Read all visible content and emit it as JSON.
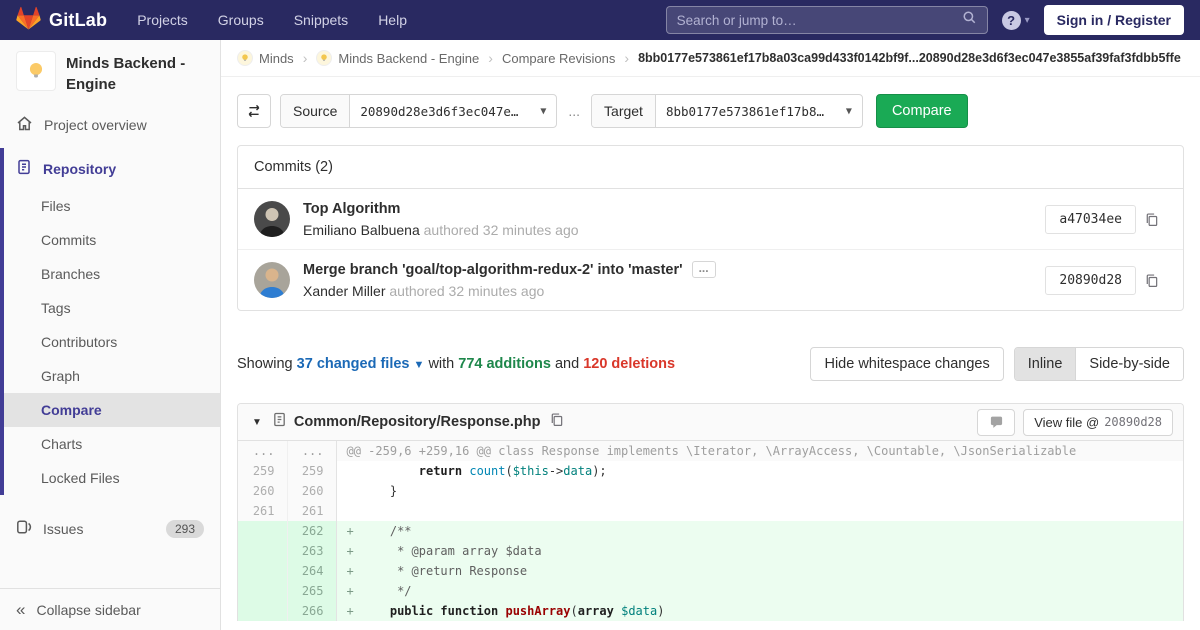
{
  "navbar": {
    "brand": "GitLab",
    "links": [
      "Projects",
      "Groups",
      "Snippets",
      "Help"
    ],
    "search_placeholder": "Search or jump to…",
    "signin_label": "Sign in / Register"
  },
  "sidebar": {
    "project_title": "Minds Backend - Engine",
    "overview_label": "Project overview",
    "repository_label": "Repository",
    "repo_items": [
      "Files",
      "Commits",
      "Branches",
      "Tags",
      "Contributors",
      "Graph",
      "Compare",
      "Charts",
      "Locked Files"
    ],
    "active_item": "Compare",
    "issues_label": "Issues",
    "issues_count": "293",
    "collapse_label": "Collapse sidebar"
  },
  "breadcrumb": {
    "items": [
      {
        "label": "Minds",
        "avatar": true
      },
      {
        "label": "Minds Backend - Engine",
        "avatar": true
      },
      {
        "label": "Compare Revisions",
        "avatar": false
      }
    ],
    "current": "8bb0177e573861ef17b8a03ca99d433f0142bf9f...20890d28e3d6f3ec047e3855af39faf3fdbb5ffe"
  },
  "compare_form": {
    "source_label": "Source",
    "source_value": "20890d28e3d6f3ec047e…",
    "separator": "...",
    "target_label": "Target",
    "target_value": "8bb0177e573861ef17b8…",
    "compare_label": "Compare"
  },
  "commits": {
    "header": "Commits (2)",
    "items": [
      {
        "title": "Top Algorithm",
        "author": "Emiliano Balbuena",
        "authored_text": "authored 32 minutes ago",
        "sha": "a47034ee",
        "expand_button": false,
        "avatar_style": "grayscale-portrait"
      },
      {
        "title": "Merge branch 'goal/top-algorithm-redux-2' into 'master'",
        "author": "Xander Miller",
        "authored_text": "authored 32 minutes ago",
        "sha": "20890d28",
        "expand_button": true,
        "avatar_style": "blue-shirt-portrait"
      }
    ]
  },
  "summary": {
    "showing_label": "Showing",
    "files_link": "37 changed files",
    "with_label": "with",
    "additions": "774 additions",
    "and_label": "and",
    "deletions": "120 deletions",
    "whitespace_button": "Hide whitespace changes",
    "inline_label": "Inline",
    "side_by_side_label": "Side-by-side"
  },
  "diff": {
    "file_path": "Common/Repository/Response.php",
    "view_file_label": "View file @",
    "view_file_sha": "20890d28",
    "rows": [
      {
        "type": "match",
        "old": "...",
        "new": "...",
        "code": [
          {
            "t": "@@ -259,6 +259,16 @@ class Response implements \\Iterator, \\ArrayAccess, \\Countable, \\JsonSerializable",
            "c": "match"
          }
        ]
      },
      {
        "type": "ctx",
        "old": "259",
        "new": "259",
        "code": [
          {
            "t": "        ",
            "c": ""
          },
          {
            "t": "return",
            "c": "k"
          },
          {
            "t": " ",
            "c": ""
          },
          {
            "t": "count",
            "c": "fn"
          },
          {
            "t": "(",
            "c": ""
          },
          {
            "t": "$this",
            "c": "var"
          },
          {
            "t": "->",
            "c": ""
          },
          {
            "t": "data",
            "c": "var"
          },
          {
            "t": ");",
            "c": ""
          }
        ]
      },
      {
        "type": "ctx",
        "old": "260",
        "new": "260",
        "code": [
          {
            "t": "    }",
            "c": ""
          }
        ]
      },
      {
        "type": "ctx",
        "old": "261",
        "new": "261",
        "code": []
      },
      {
        "type": "add",
        "old": "",
        "new": "262",
        "code": [
          {
            "t": "    ",
            "c": ""
          },
          {
            "t": "/**",
            "c": "cm"
          }
        ]
      },
      {
        "type": "add",
        "old": "",
        "new": "263",
        "code": [
          {
            "t": "     * @param array $data",
            "c": "cm"
          }
        ]
      },
      {
        "type": "add",
        "old": "",
        "new": "264",
        "code": [
          {
            "t": "     * @return Response",
            "c": "cm"
          }
        ]
      },
      {
        "type": "add",
        "old": "",
        "new": "265",
        "code": [
          {
            "t": "     */",
            "c": "cm"
          }
        ]
      },
      {
        "type": "add",
        "old": "",
        "new": "266",
        "code": [
          {
            "t": "    ",
            "c": ""
          },
          {
            "t": "public function",
            "c": "k"
          },
          {
            "t": " ",
            "c": ""
          },
          {
            "t": "pushArray",
            "c": "fnd"
          },
          {
            "t": "(",
            "c": ""
          },
          {
            "t": "array",
            "c": "k"
          },
          {
            "t": " ",
            "c": ""
          },
          {
            "t": "$data",
            "c": "var"
          },
          {
            "t": ")",
            "c": ""
          }
        ]
      }
    ]
  },
  "colors": {
    "navbar_bg": "#292961",
    "accent_indigo": "#423d96",
    "compare_button_green": "#1aaa55",
    "additions_green": "#1e874b",
    "deletions_red": "#d9372a",
    "link_blue": "#1b69b6",
    "added_line_bg": "#ecfdf0"
  },
  "icons": {
    "logo": "gitlab-tanuki",
    "search": "magnifier",
    "help": "question-circle",
    "project_avatar": "lightbulb",
    "overview": "home",
    "repository": "document",
    "issues": "issue-open",
    "collapse": "double-chevron-left",
    "swap": "arrows-left-right",
    "copy": "clipboard-copy",
    "comment": "speech-bubble"
  }
}
